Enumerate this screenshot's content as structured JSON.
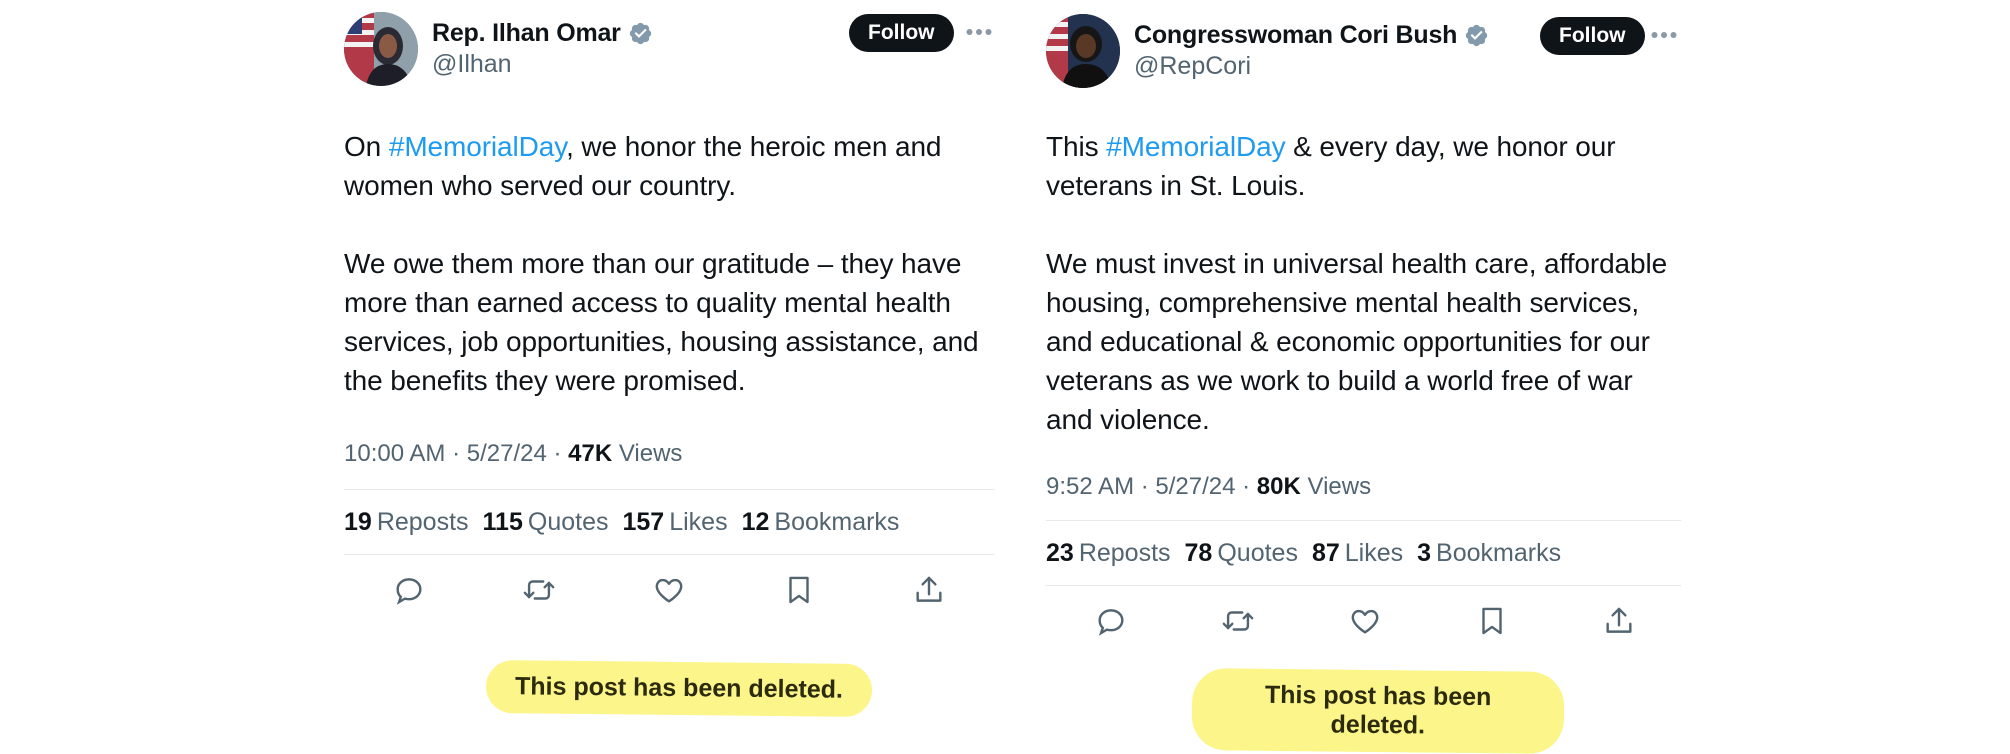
{
  "posts": [
    {
      "display_name": "Rep. Ilhan Omar",
      "handle": "@Ilhan",
      "follow_label": "Follow",
      "text": {
        "p1_before": "On ",
        "p1_hashtag": "#MemorialDay",
        "p1_after": ", we honor the heroic men and women who served our country.",
        "p2": "We owe them more than our gratitude – they have more than earned access to quality mental health services, job opportunities, housing assistance, and the benefits they were promised."
      },
      "time": "10:00 AM",
      "date": "5/27/24",
      "views_count": "47K",
      "views_label": "Views",
      "stats": {
        "reposts": "19",
        "reposts_label": "Reposts",
        "quotes": "115",
        "quotes_label": "Quotes",
        "likes": "157",
        "likes_label": "Likes",
        "bookmarks": "12",
        "bookmarks_label": "Bookmarks"
      },
      "deleted_notice": "This post has been deleted."
    },
    {
      "display_name": "Congresswoman Cori Bush",
      "handle": "@RepCori",
      "follow_label": "Follow",
      "text": {
        "p1_before": "This ",
        "p1_hashtag": "#MemorialDay",
        "p1_after": " & every day, we honor our veterans in St. Louis.",
        "p2": "We must invest in universal health care, affordable housing, comprehensive mental health services, and educational & economic opportunities for our veterans as we work to build a world free of war and violence."
      },
      "time": "9:52 AM",
      "date": "5/27/24",
      "views_count": "80K",
      "views_label": "Views",
      "stats": {
        "reposts": "23",
        "reposts_label": "Reposts",
        "quotes": "78",
        "quotes_label": "Quotes",
        "likes": "87",
        "likes_label": "Likes",
        "bookmarks": "3",
        "bookmarks_label": "Bookmarks"
      },
      "deleted_notice": "This post has been deleted."
    }
  ],
  "icons": {
    "verified": "verified-badge-icon",
    "more": "more-options-icon",
    "reply": "reply-icon",
    "repost": "repost-icon",
    "like": "like-icon",
    "bookmark": "bookmark-icon",
    "share": "share-icon"
  },
  "colors": {
    "hashtag": "#1d9bf0",
    "secondary_text": "#536471",
    "primary_text": "#0f1419",
    "verified_badge": "#829aab",
    "highlight": "#fbf58a"
  }
}
